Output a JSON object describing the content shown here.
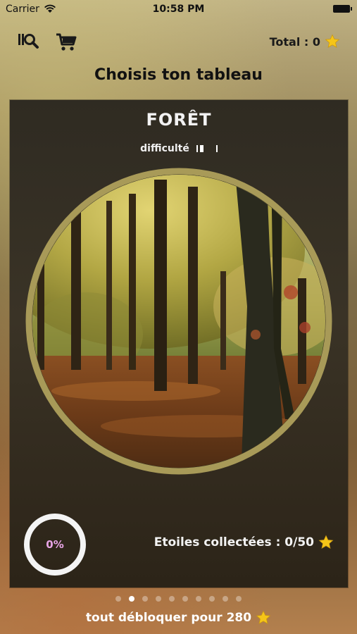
{
  "status_bar": {
    "carrier": "Carrier",
    "time": "10:58 PM"
  },
  "top_bar": {
    "search_icon": "search-settings-icon",
    "cart_icon": "shopping-cart-icon",
    "total_label": "Total : 0"
  },
  "page": {
    "title": "Choisis ton tableau"
  },
  "card": {
    "name": "FORÊT",
    "difficulty_label": "difficulté",
    "difficulty_level": 0.33,
    "progress_label": "0%",
    "progress_value": 0,
    "stars_label": "Etoiles collectées : 0/50"
  },
  "pager": {
    "count": 10,
    "active_index": 1
  },
  "unlock": {
    "label": "tout débloquer pour 280"
  },
  "colors": {
    "ring": "#a89a58",
    "star": "#f5c518",
    "progress_text": "#e8a4e6"
  }
}
